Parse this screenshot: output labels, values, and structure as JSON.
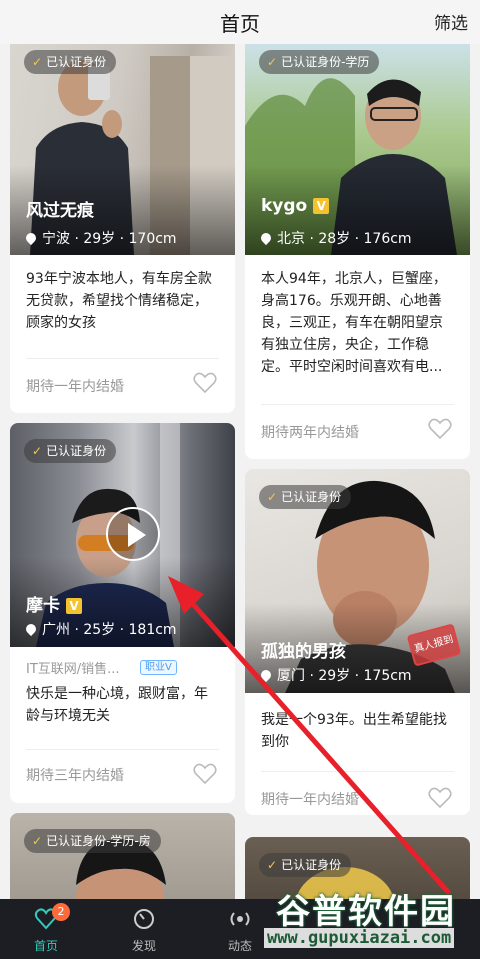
{
  "header": {
    "title": "首页",
    "filter": "筛选"
  },
  "cards": [
    {
      "badge": "已认证身份",
      "name": "风过无痕",
      "location": "宁波 · 29岁 · 170cm",
      "description": "93年宁波本地人，有车房全款无贷款，希望找个情绪稳定，顾家的女孩",
      "goal": "期待一年内结婚"
    },
    {
      "badge": "已认证身份-学历",
      "name": "kygo",
      "location": "北京 · 28岁 · 176cm",
      "description": "本人94年，北京人，巨蟹座，身高176。乐观开朗、心地善良，三观正，有车在朝阳望京有独立住房，央企，工作稳定。平时空闲时间喜欢有电...",
      "goal": "期待两年内结婚"
    },
    {
      "badge": "已认证身份",
      "name": "摩卡",
      "location": "广州 · 25岁 · 181cm",
      "job": "IT互联网/销售...",
      "job_tag": "职业V",
      "description": "快乐是一种心境，跟财富，年龄与环境无关",
      "goal": "期待三年内结婚"
    },
    {
      "badge": "已认证身份",
      "name": "孤独的男孩",
      "location": "厦门 · 29岁 · 175cm",
      "stamp": "真人报到",
      "description": "我是一个93年。出生希望能找到你",
      "goal": "期待一年内结婚"
    },
    {
      "badge": "已认证身份-学历-房"
    },
    {
      "badge": "已认证身份"
    }
  ],
  "vmark": "V",
  "tabbar": {
    "tabs": [
      {
        "label": "首页",
        "badge": "2"
      },
      {
        "label": "发现"
      },
      {
        "label": "动态"
      }
    ]
  },
  "watermark": {
    "text": "谷普软件园",
    "url": "www.gupuxiazai.com"
  },
  "colors": {
    "accent": "#36c9b8",
    "tabbar": "#1d1d24",
    "badge": "#ff6a3a",
    "arrow": "#e8202a"
  }
}
